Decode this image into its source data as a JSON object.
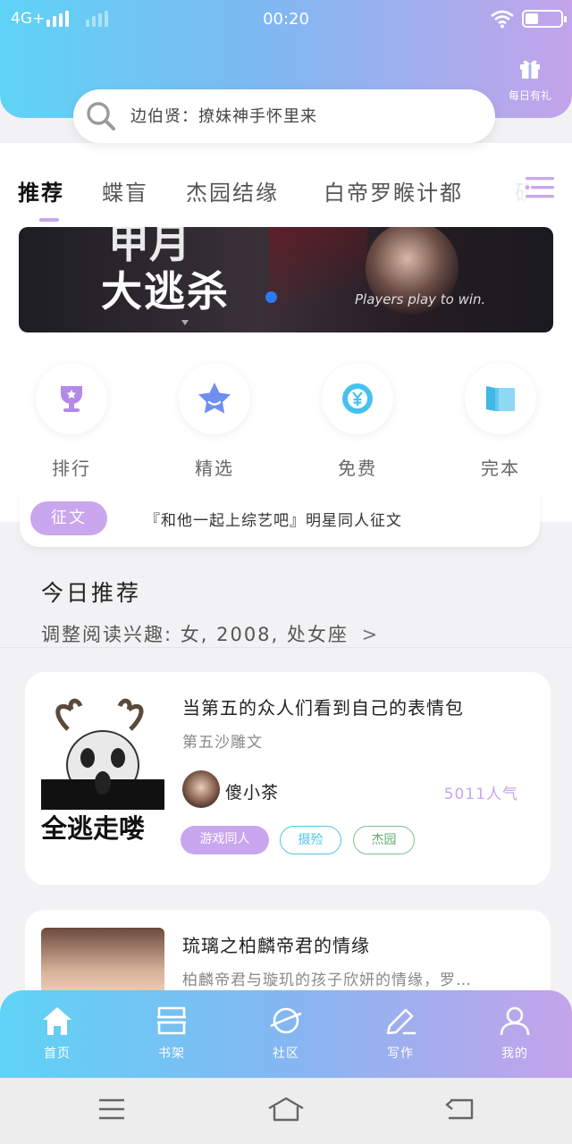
{
  "status_bar": {
    "carrier": "4G+",
    "time": "00:20"
  },
  "header": {
    "gift_label": "每日有礼",
    "search_placeholder": "边伯贤：撩妹神手怀里来"
  },
  "tabs": [
    "推荐",
    "蝶盲",
    "杰园结缘",
    "白帝罗睺计都",
    "研"
  ],
  "banner": {
    "title_line1": "甲月",
    "title_line2": "大逃杀",
    "subtitle": "Players play to win."
  },
  "quick_entries": [
    {
      "label": "排行",
      "icon": "trophy-icon"
    },
    {
      "label": "精选",
      "icon": "star-icon"
    },
    {
      "label": "免费",
      "icon": "yen-refresh-icon"
    },
    {
      "label": "完本",
      "icon": "book-icon"
    }
  ],
  "notice": {
    "badge": "征文",
    "text": "『和他一起上综艺吧』明星同人征文"
  },
  "today": {
    "title": "今日推荐",
    "interest": "调整阅读兴趣: 女, 2008, 处女座"
  },
  "books": [
    {
      "title": "当第五的众人们看到自己的表情包",
      "desc": "第五沙雕文",
      "cover_text": "全逃走喽",
      "author": "傻小茶",
      "popularity": "5011人气",
      "tags": [
        "游戏同人",
        "摄殓",
        "杰园"
      ]
    },
    {
      "title": "琉璃之柏麟帝君的情缘",
      "desc": "柏麟帝君与璇玑的孩子欣妍的情缘，罗…"
    }
  ],
  "tabbar": [
    "首页",
    "书架",
    "社区",
    "写作",
    "我的"
  ],
  "colors": {
    "accent_purple": "#c9a6ee",
    "accent_cyan": "#4ec4ea",
    "accent_green": "#7cc08a",
    "banner_dot": "#2a7cf6"
  }
}
